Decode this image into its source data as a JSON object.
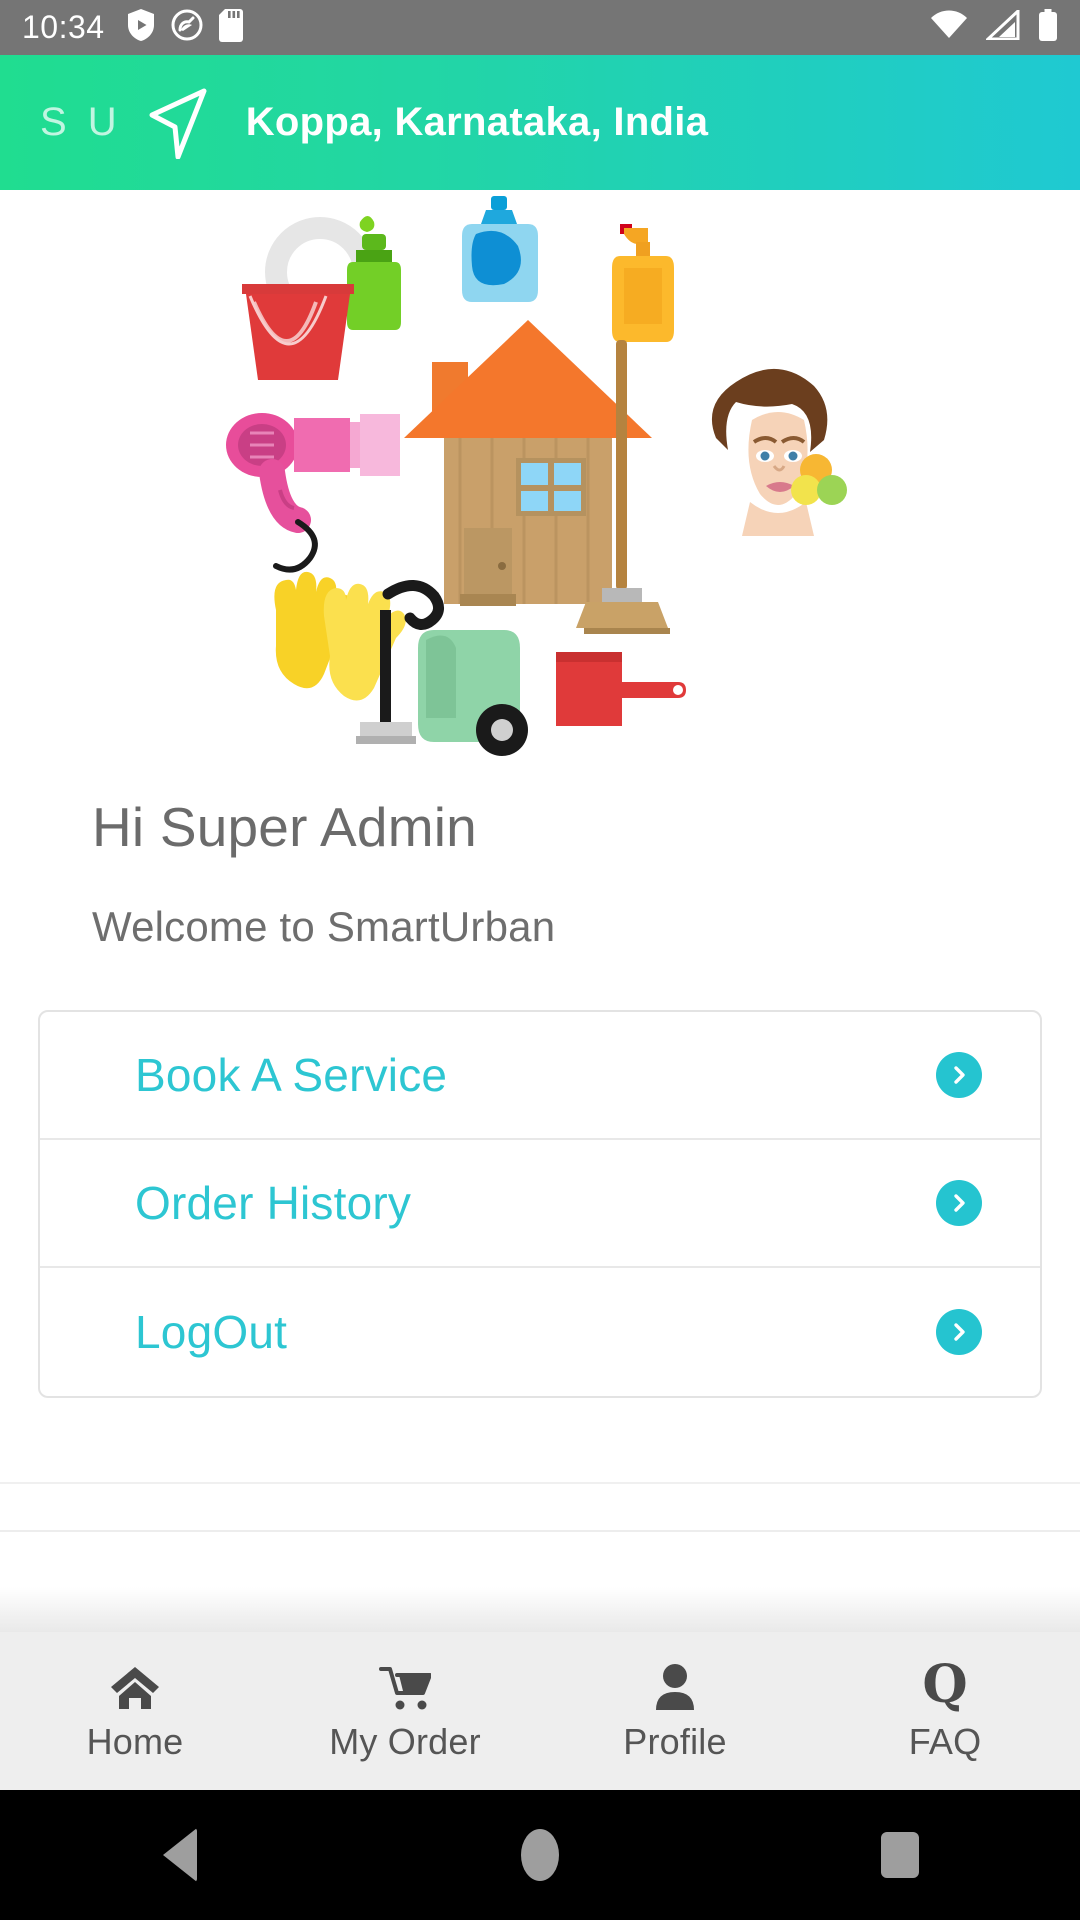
{
  "status_bar": {
    "time": "10:34",
    "left_icons": [
      "shield-play-icon",
      "privacy-camera-icon",
      "sd-card-icon"
    ],
    "right_icons": [
      "wifi-icon",
      "cellular-signal-icon",
      "battery-icon"
    ],
    "background_color": "#757575"
  },
  "app_bar": {
    "brand": "S U",
    "nav_icon": "location-arrow-icon",
    "title": "Koppa, Karnataka, India",
    "gradient_from": "#20dd90",
    "gradient_to": "#1fc9d2"
  },
  "hero": {
    "illustration_name": "home-cleaning-services-illustration",
    "items": [
      "plate-icon",
      "green-spray-bottle",
      "blue-detergent-bottle",
      "orange-spray-bottle",
      "red-bucket",
      "pink-hair-dryer",
      "house-illustration",
      "broom",
      "woman-face-with-sponges",
      "yellow-rubber-gloves",
      "green-vacuum-cleaner",
      "red-dustpan"
    ]
  },
  "greeting": {
    "main": "Hi Super Admin",
    "sub": "Welcome to SmartUrban"
  },
  "menu": {
    "accent_color": "#2dc6d2",
    "items": [
      {
        "label": "Book A Service",
        "icon": "chevron-right-icon"
      },
      {
        "label": "Order History",
        "icon": "chevron-right-icon"
      },
      {
        "label": "LogOut",
        "icon": "chevron-right-icon"
      }
    ]
  },
  "bottom_nav": {
    "background_color": "#eeeeee",
    "tabs": [
      {
        "label": "Home",
        "icon": "home-icon"
      },
      {
        "label": "My Order",
        "icon": "shopping-cart-icon"
      },
      {
        "label": "Profile",
        "icon": "person-icon"
      },
      {
        "label": "FAQ",
        "icon": "question-q-icon",
        "glyph": "Q"
      }
    ]
  },
  "android_nav": {
    "back": "back-triangle-icon",
    "home": "home-circle-icon",
    "recents": "recents-square-icon"
  }
}
